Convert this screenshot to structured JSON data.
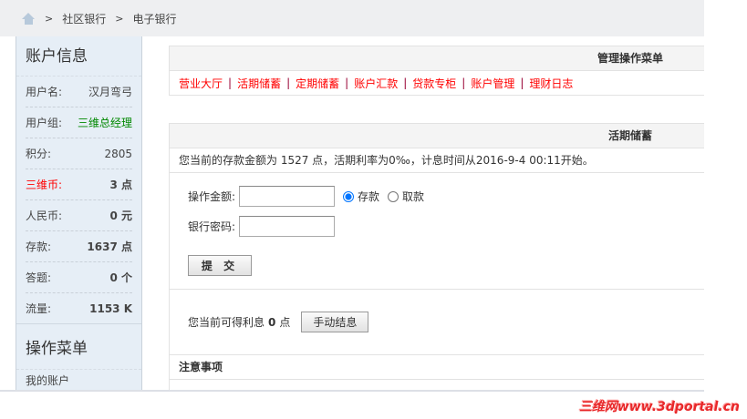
{
  "breadcrumb": {
    "items": [
      "社区银行",
      "电子银行"
    ],
    "separator": ">"
  },
  "sidebar": {
    "title": "账户信息",
    "rows": [
      {
        "label": "用户名:",
        "value": "汉月弯弓"
      },
      {
        "label": "用户组:",
        "value": "三维总经理"
      },
      {
        "label": "积分:",
        "value": "2805"
      },
      {
        "label": "三维币:",
        "value": "3 点"
      },
      {
        "label": "人民币:",
        "value": "0 元"
      },
      {
        "label": "存款:",
        "value": "1637 点"
      },
      {
        "label": "答题:",
        "value": "0 个"
      },
      {
        "label": "流量:",
        "value": "1153 K"
      }
    ],
    "menu_title": "操作菜单",
    "menu_items": [
      "我的账户"
    ]
  },
  "nav_panel": {
    "title": "管理操作菜单",
    "links": [
      "营业大厅",
      "活期储蓄",
      "定期储蓄",
      "账户汇款",
      "贷款专柜",
      "账户管理",
      "理财日志"
    ],
    "separator": "|"
  },
  "savings": {
    "title": "活期储蓄",
    "info": "您当前的存款金额为 1527 点，活期利率为0‰，计息时间从2016-9-4 00:11开始。",
    "amount_label": "操作金额:",
    "amount_value": "",
    "deposit_label": "存款",
    "withdraw_label": "取款",
    "selected": "存款",
    "password_label": "银行密码:",
    "password_value": "",
    "submit_label": "提 交",
    "interest_prefix": "您当前可得利息",
    "interest_value": "0",
    "interest_unit": "点",
    "settle_label": "手动结息",
    "notice_title": "注意事项"
  },
  "watermark": "三维网www.3dportal.cn"
}
